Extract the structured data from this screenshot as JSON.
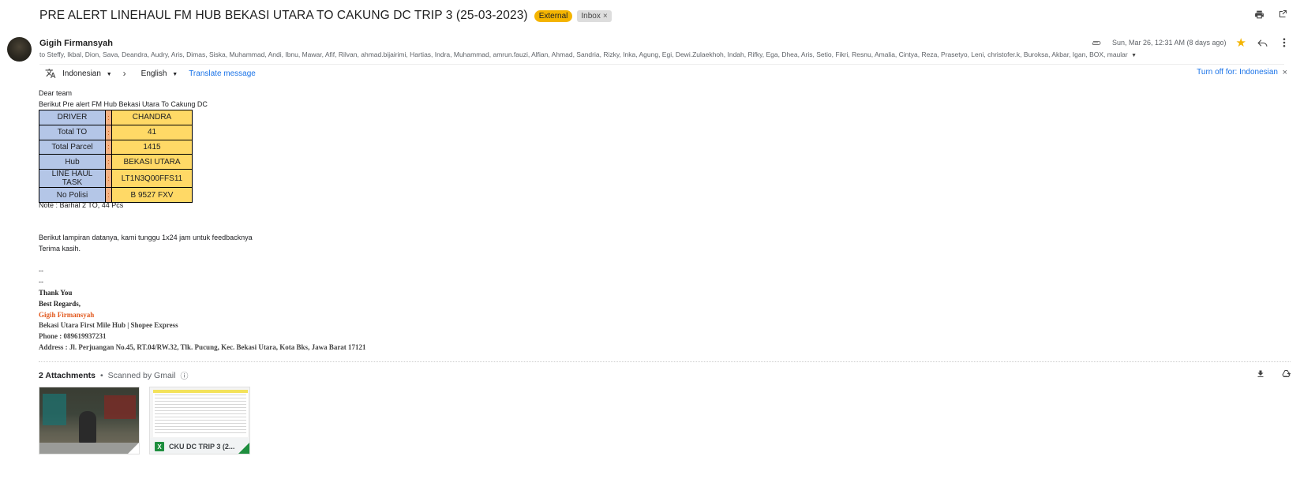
{
  "email": {
    "subject": "PRE ALERT LINEHAUL FM HUB BEKASI UTARA TO CAKUNG DC TRIP 3 (25-03-2023)",
    "labels": {
      "external": "External",
      "inbox": "Inbox",
      "inbox_remove": "×"
    },
    "sender": "Gigih Firmansyah",
    "recipients": "to Steffy, Ikbal, Dion, Sava, Deandra, Audry, Aris, Dimas, Siska, Muhammad, Andi, Ibnu, Mawar, Afif, Rilvan, ahmad.bijairimi, Hartias, Indra, Muhammad, amrun.fauzi, Alfian, Ahmad, Sandria, Rizky, Inka, Agung, Egi, Dewi.Zulaekhoh, Indah, Rifky, Ega, Dhea, Aris, Setio, Fikri, Resnu, Amalia, Cintya, Reza, Prasetyo, Leni, christofer.k, Buroksa, Akbar, Igan, BOX, maular",
    "date": "Sun, Mar 26, 12:31 AM (8 days ago)"
  },
  "translate": {
    "from": "Indonesian",
    "to": "English",
    "link": "Translate message",
    "turn_off": "Turn off for: Indonesian"
  },
  "body": {
    "greeting": "Dear team",
    "intro": "Berikut Pre alert FM Hub Bekasi Utara To Cakung DC",
    "table": [
      {
        "key": "DRIVER",
        "sep": ":",
        "value": "CHANDRA"
      },
      {
        "key": "Total TO",
        "sep": ":",
        "value": "41"
      },
      {
        "key": "Total Parcel",
        "sep": ":",
        "value": "1415"
      },
      {
        "key": "Hub",
        "sep": ":",
        "value": "BEKASI UTARA"
      },
      {
        "key": "LINE HAUL TASK",
        "sep": ":",
        "value": "LT1N3Q00FFS11"
      },
      {
        "key": "No Polisi",
        "sep": ":",
        "value": "B 9527 FXV"
      }
    ],
    "note": "Note : Barhal 2 TO, 44 Pcs",
    "attachment_text": "Berikut lampiran datanya, kami tunggu 1x24 jam untuk feedbacknya",
    "thanks": "Terima kasih.",
    "dash1": "--",
    "dash2": "--"
  },
  "signature": {
    "thank_you": "Thank You",
    "regards": "Best Regards,",
    "name": "Gigih Firmansyah",
    "company": "Bekasi Utara First Mile Hub |  Shopee Express",
    "phone": "Phone : 089619937231",
    "address": "Address : Jl. Perjuangan No.45, RT.04/RW.32, Tlk. Pucung, Kec. Bekasi Utara, Kota Bks, Jawa Barat 17121"
  },
  "attachments": {
    "count_label": "2 Attachments",
    "separator": "•",
    "scanned": "Scanned by Gmail",
    "file2_name": "CKU DC TRIP 3 (2...",
    "file2_icon_letter": "X"
  }
}
